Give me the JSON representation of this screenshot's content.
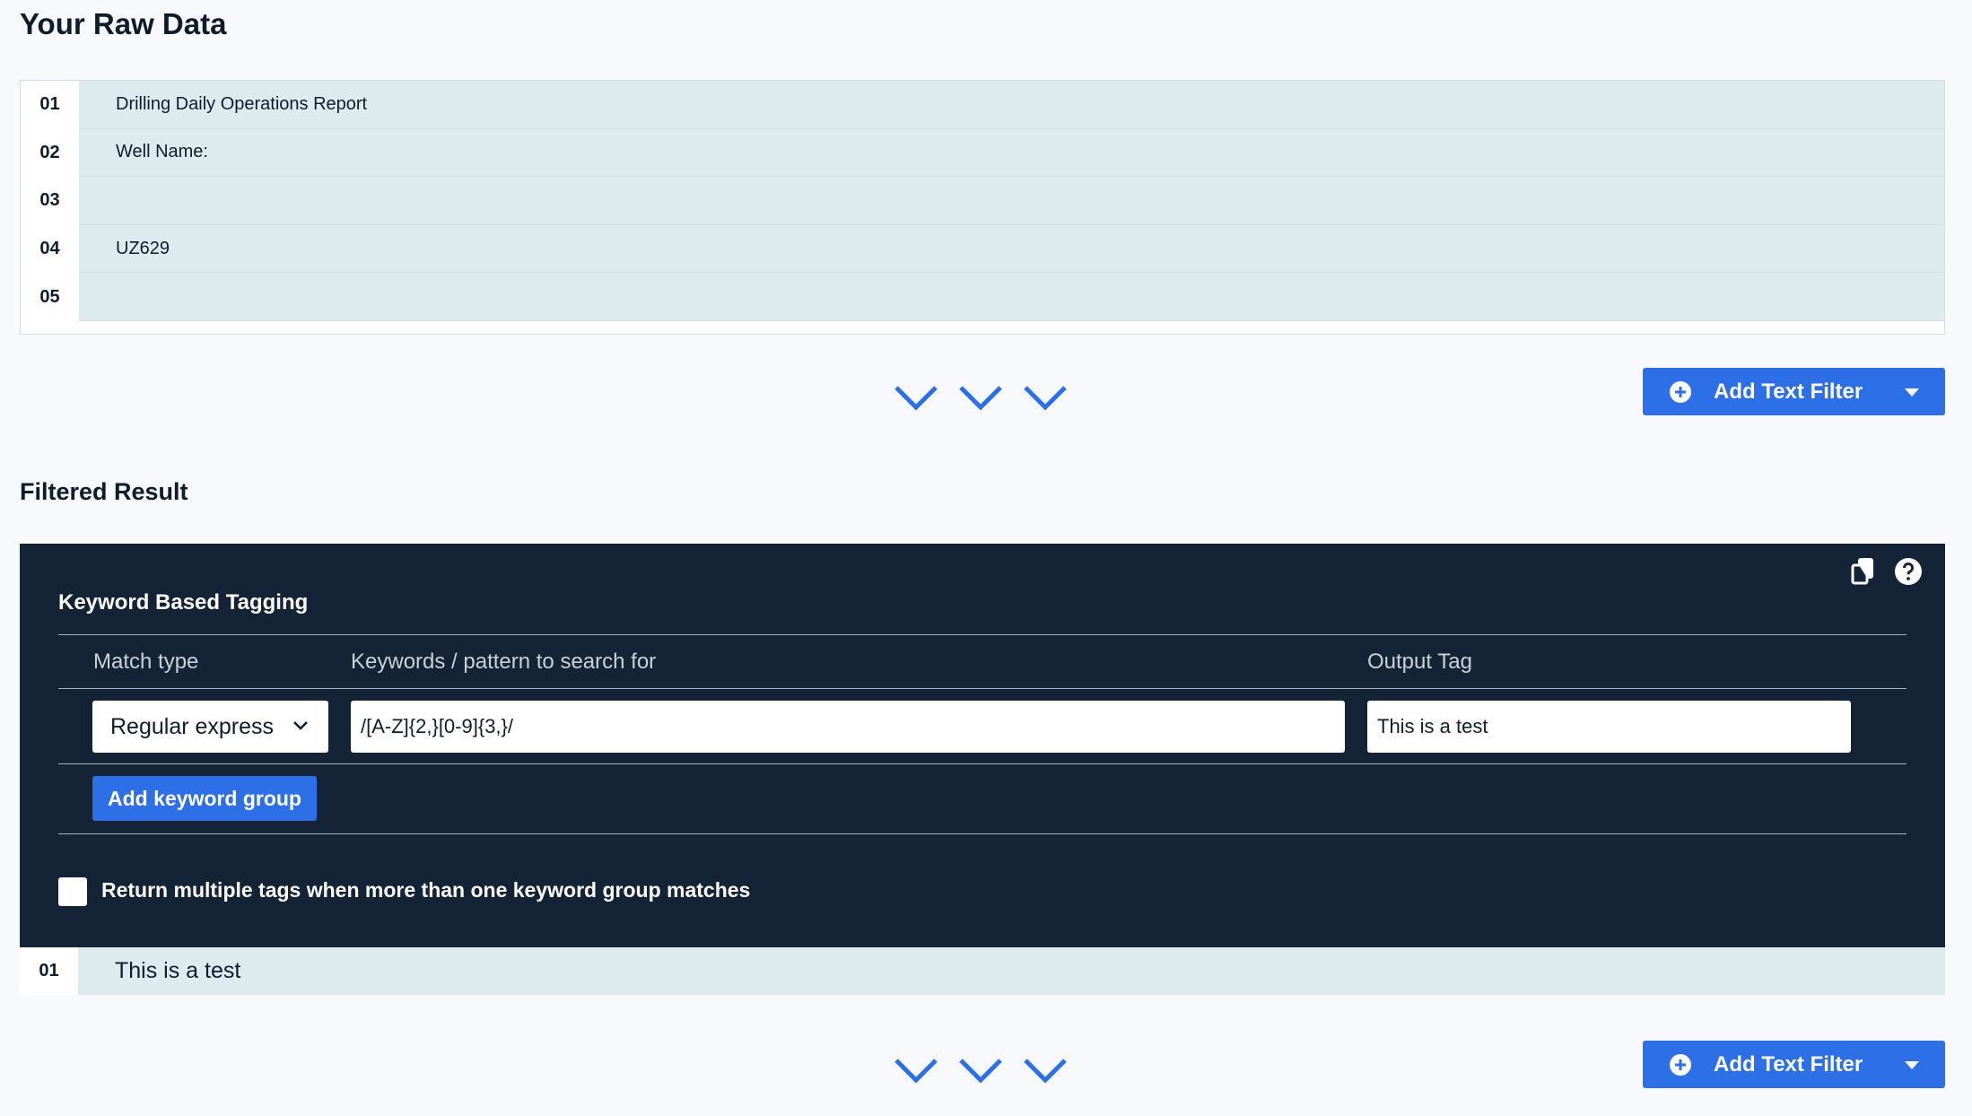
{
  "raw_section": {
    "title": "Your Raw Data",
    "rows": [
      {
        "num": "01",
        "text": "Drilling Daily Operations Report"
      },
      {
        "num": "02",
        "text": "Well Name:"
      },
      {
        "num": "03",
        "text": ""
      },
      {
        "num": "04",
        "text": "UZ629"
      },
      {
        "num": "05",
        "text": ""
      }
    ]
  },
  "add_filter": {
    "label": "Add Text Filter"
  },
  "filtered_section": {
    "title": "Filtered Result"
  },
  "panel": {
    "title": "Keyword Based Tagging",
    "columns": {
      "match_type": "Match type",
      "keywords": "Keywords / pattern to search for",
      "output_tag": "Output Tag"
    },
    "match_type_value": "Regular express",
    "keyword_value": "/[A-Z]{2,}[0-9]{3,}/",
    "output_tag_value": "This is a test",
    "add_group_label": "Add keyword group",
    "checkbox_label": "Return multiple tags when more than one keyword group matches"
  },
  "result_rows": [
    {
      "num": "01",
      "text": "This is a test"
    }
  ],
  "colors": {
    "accent": "#2c6fe6",
    "panel_bg": "#142335",
    "row_bg": "#ddebef"
  }
}
